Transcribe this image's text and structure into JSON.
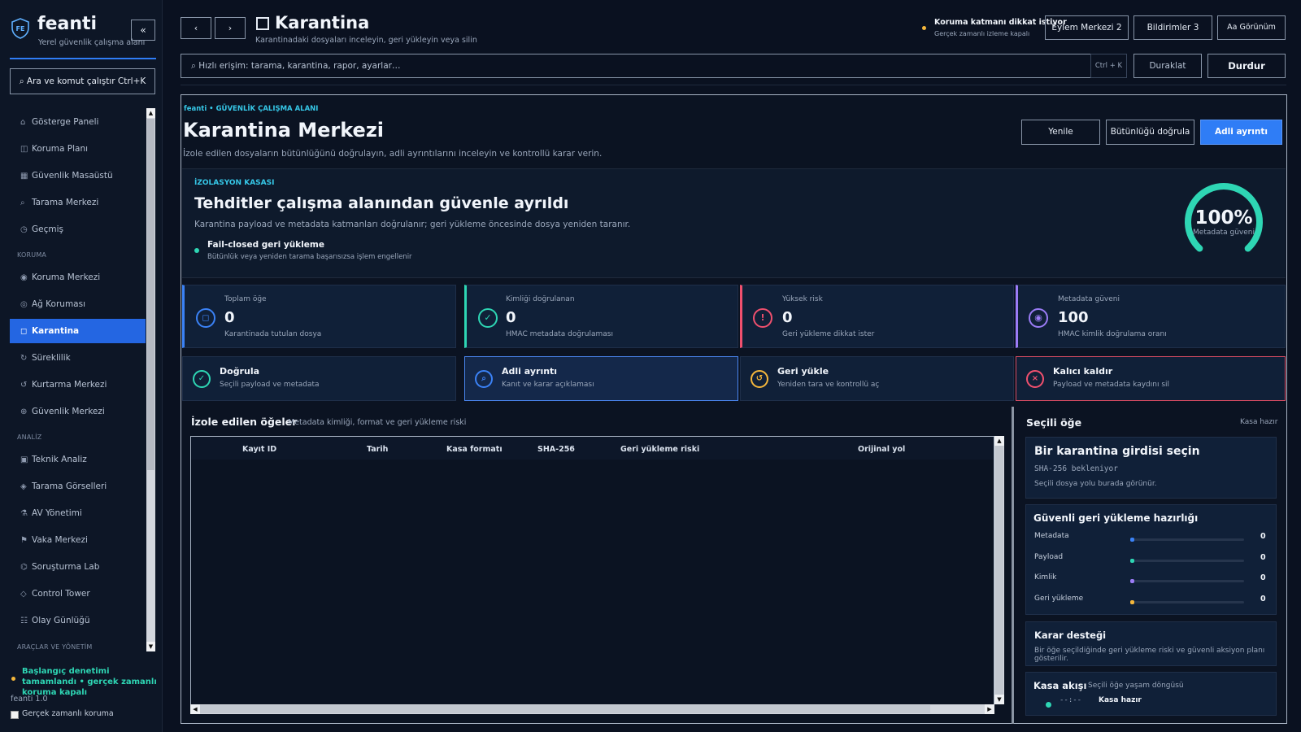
{
  "sidebar": {
    "brand": "feanti",
    "brand_sub": "Yerel güvenlik çalışma alanı",
    "logo_text": "FE",
    "collapse": "«",
    "command_button": "⌕ Ara ve komut çalıştır   Ctrl+K",
    "nav": [
      {
        "icon": "⌂",
        "label": "Gösterge Paneli"
      },
      {
        "icon": "◫",
        "label": "Koruma Planı"
      },
      {
        "icon": "▦",
        "label": "Güvenlik Masaüstü"
      },
      {
        "icon": "⌕",
        "label": "Tarama Merkezi"
      },
      {
        "icon": "◷",
        "label": "Geçmiş"
      },
      {
        "icon": "◉",
        "label": "Koruma Merkezi"
      },
      {
        "icon": "◎",
        "label": "Ağ Koruması"
      },
      {
        "icon": "◻",
        "label": "Karantina"
      },
      {
        "icon": "↻",
        "label": "Süreklilik"
      },
      {
        "icon": "↺",
        "label": "Kurtarma Merkezi"
      },
      {
        "icon": "⊕",
        "label": "Güvenlik Merkezi"
      },
      {
        "icon": "▣",
        "label": "Teknik Analiz"
      },
      {
        "icon": "◈",
        "label": "Tarama Görselleri"
      },
      {
        "icon": "⚗",
        "label": "AV Yönetimi"
      },
      {
        "icon": "⚑",
        "label": "Vaka Merkezi"
      },
      {
        "icon": "⌬",
        "label": "Soruşturma Lab"
      },
      {
        "icon": "◇",
        "label": "Control Tower"
      },
      {
        "icon": "☷",
        "label": "Olay Günlüğü"
      }
    ],
    "sections": [
      "KORUMA",
      "ANALİZ",
      "ARAÇLAR VE YÖNETİM"
    ],
    "status": "Başlangıç denetimi tamamlandı • gerçek zamanlı koruma kapalı",
    "version": "feanti 1.0",
    "realtime_label": "Gerçek zamanlı koruma"
  },
  "header": {
    "back": "‹",
    "forward": "›",
    "title": "Karantina",
    "subtitle": "Karantinadaki dosyaları inceleyin, geri yükleyin veya silin",
    "alert_title": "Koruma katmanı dikkat istiyor",
    "alert_sub": "Gerçek zamanlı izleme kapalı",
    "action_center": "Eylem Merkezi  2",
    "notifications": "Bildirimler 3",
    "view": "Aa Görünüm",
    "search_placeholder": "⌕  Hızlı erişim: tarama, karantina, rapor, ayarlar…",
    "shortcut": "Ctrl + K",
    "pause": "Duraklat",
    "stop": "Durdur"
  },
  "page": {
    "breadcrumb": "feanti • GÜVENLİK ÇALIŞMA ALANI",
    "title": "Karantina Merkezi",
    "subtitle": "İzole edilen dosyaların bütünlüğünü doğrulayın, adli ayrıntılarını inceleyin ve kontrollü karar verin.",
    "refresh": "Yenile",
    "verify": "Bütünlüğü doğrula",
    "forensic": "Adli ayrıntı"
  },
  "hero": {
    "tag": "İZOLASYON KASASI",
    "title": "Tehditler çalışma alanından güvenle ayrıldı",
    "subtitle": "Karantina payload ve metadata katmanları doğrulanır; geri yükleme öncesinde dosya yeniden taranır.",
    "feature": "Fail-closed geri yükleme",
    "feature_sub": "Bütünlük veya yeniden tarama başarısızsa işlem engellenir",
    "gauge_value": "100%",
    "gauge_label": "Metadata güveni",
    "gauge_fraction": 1.0
  },
  "stats": [
    {
      "label": "Toplam öğe",
      "value": "0",
      "sub": "Karantinada tutulan dosya",
      "icon": "◻",
      "color": "#3b82f6"
    },
    {
      "label": "Kimliği doğrulanan",
      "value": "0",
      "sub": "HMAC metadata doğrulaması",
      "icon": "✓",
      "color": "#2ed6b4"
    },
    {
      "label": "Yüksek risk",
      "value": "0",
      "sub": "Geri yükleme dikkat ister",
      "icon": "!",
      "color": "#f0506e"
    },
    {
      "label": "Metadata güveni",
      "value": "100",
      "sub": "HMAC kimlik doğrulama oranı",
      "icon": "◉",
      "color": "#9b7cf6"
    }
  ],
  "actions": [
    {
      "title": "Doğrula",
      "sub": "Seçili payload ve metadata",
      "icon": "✓",
      "color": "#2ed6b4"
    },
    {
      "title": "Adli ayrıntı",
      "sub": "Kanıt ve karar açıklaması",
      "icon": "⌕",
      "color": "#3b82f6"
    },
    {
      "title": "Geri yükle",
      "sub": "Yeniden tara ve kontrollü aç",
      "icon": "↺",
      "color": "#f5b73b"
    },
    {
      "title": "Kalıcı kaldır",
      "sub": "Payload ve metadata kaydını sil",
      "icon": "×",
      "color": "#f0506e"
    }
  ],
  "table": {
    "title": "İzole edilen öğeler",
    "subtitle": "Metadata kimliği, format ve geri yükleme riski",
    "columns": [
      "Kayıt ID",
      "Tarih",
      "Kasa formatı",
      "SHA-256",
      "Geri yükleme riski",
      "Orijinal yol"
    ]
  },
  "detail": {
    "title": "Seçili öğe",
    "status": "Kasa hazır",
    "select_title": "Bir karantina girdisi seçin",
    "hash": "SHA-256 bekleniyor",
    "path": "Seçili dosya yolu burada görünür.",
    "readiness_title": "Güvenli geri yükleme hazırlığı",
    "readiness": [
      {
        "label": "Metadata",
        "value": "0",
        "fraction": 0,
        "color": "#3b82f6"
      },
      {
        "label": "Payload",
        "value": "0",
        "fraction": 0,
        "color": "#2ed6b4"
      },
      {
        "label": "Kimlik",
        "value": "0",
        "fraction": 0,
        "color": "#9b7cf6"
      },
      {
        "label": "Geri yükleme",
        "value": "0",
        "fraction": 0,
        "color": "#f5b73b"
      }
    ],
    "decision_title": "Karar desteği",
    "decision_sub": "Bir öğe seçildiğinde geri yükleme riski ve güvenli aksiyon planı gösterilir.",
    "flow_title": "Kasa akışı",
    "flow_sub": "Seçili öğe yaşam döngüsü",
    "flow_time": "--:--",
    "flow_step": "Kasa hazır"
  }
}
